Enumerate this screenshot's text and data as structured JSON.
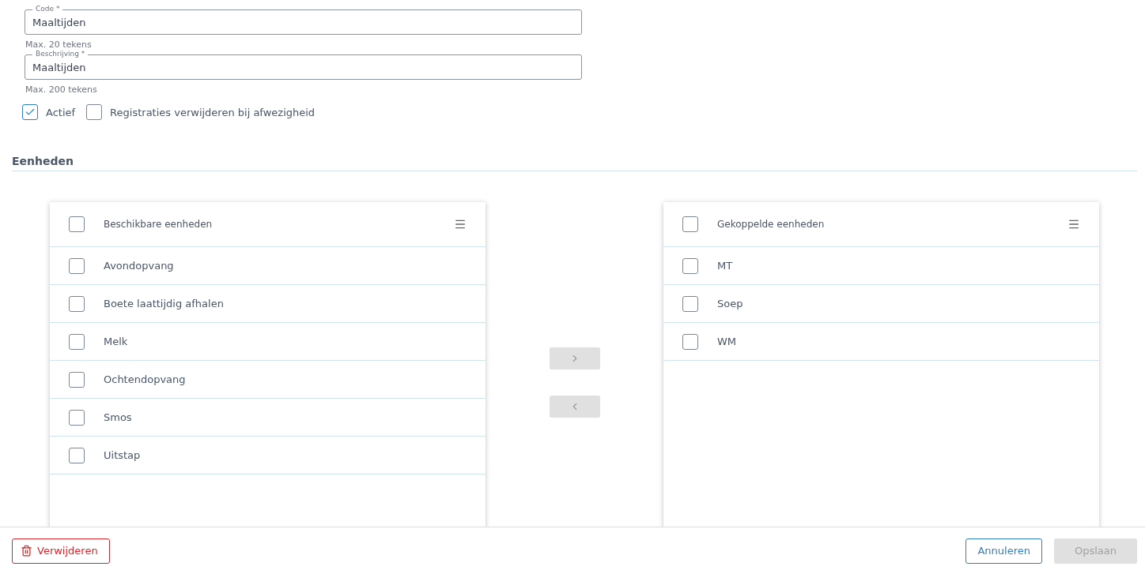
{
  "fields": [
    {
      "label": "Code *",
      "value": "Maaltijden",
      "hint": "Max. 20 tekens"
    },
    {
      "label": "Beschrijving *",
      "value": "Maaltijden",
      "hint": "Max. 200 tekens"
    }
  ],
  "options": [
    {
      "label": "Actief",
      "checked": true
    },
    {
      "label": "Registraties verwijderen bij afwezigheid",
      "checked": false
    }
  ],
  "section_title": "Eenheden",
  "lists": [
    {
      "title": "Beschikbare eenheden",
      "checked": false,
      "items": [
        {
          "label": "Avondopvang",
          "checked": false
        },
        {
          "label": "Boete laattijdig afhalen",
          "checked": false
        },
        {
          "label": "Melk",
          "checked": false
        },
        {
          "label": "Ochtendopvang",
          "checked": false
        },
        {
          "label": "Smos",
          "checked": false
        },
        {
          "label": "Uitstap",
          "checked": false
        }
      ]
    },
    {
      "title": "Gekoppelde eenheden",
      "checked": false,
      "items": [
        {
          "label": "MT",
          "checked": false
        },
        {
          "label": "Soep",
          "checked": false
        },
        {
          "label": "WM",
          "checked": false
        }
      ]
    }
  ],
  "transfer_buttons": [
    {
      "kind": "right",
      "disabled": true
    },
    {
      "kind": "left",
      "disabled": true
    }
  ],
  "footer": {
    "delete_label": "Verwijderen",
    "cancel_label": "Annuleren",
    "save_label": "Opslaan",
    "save_disabled": true
  }
}
